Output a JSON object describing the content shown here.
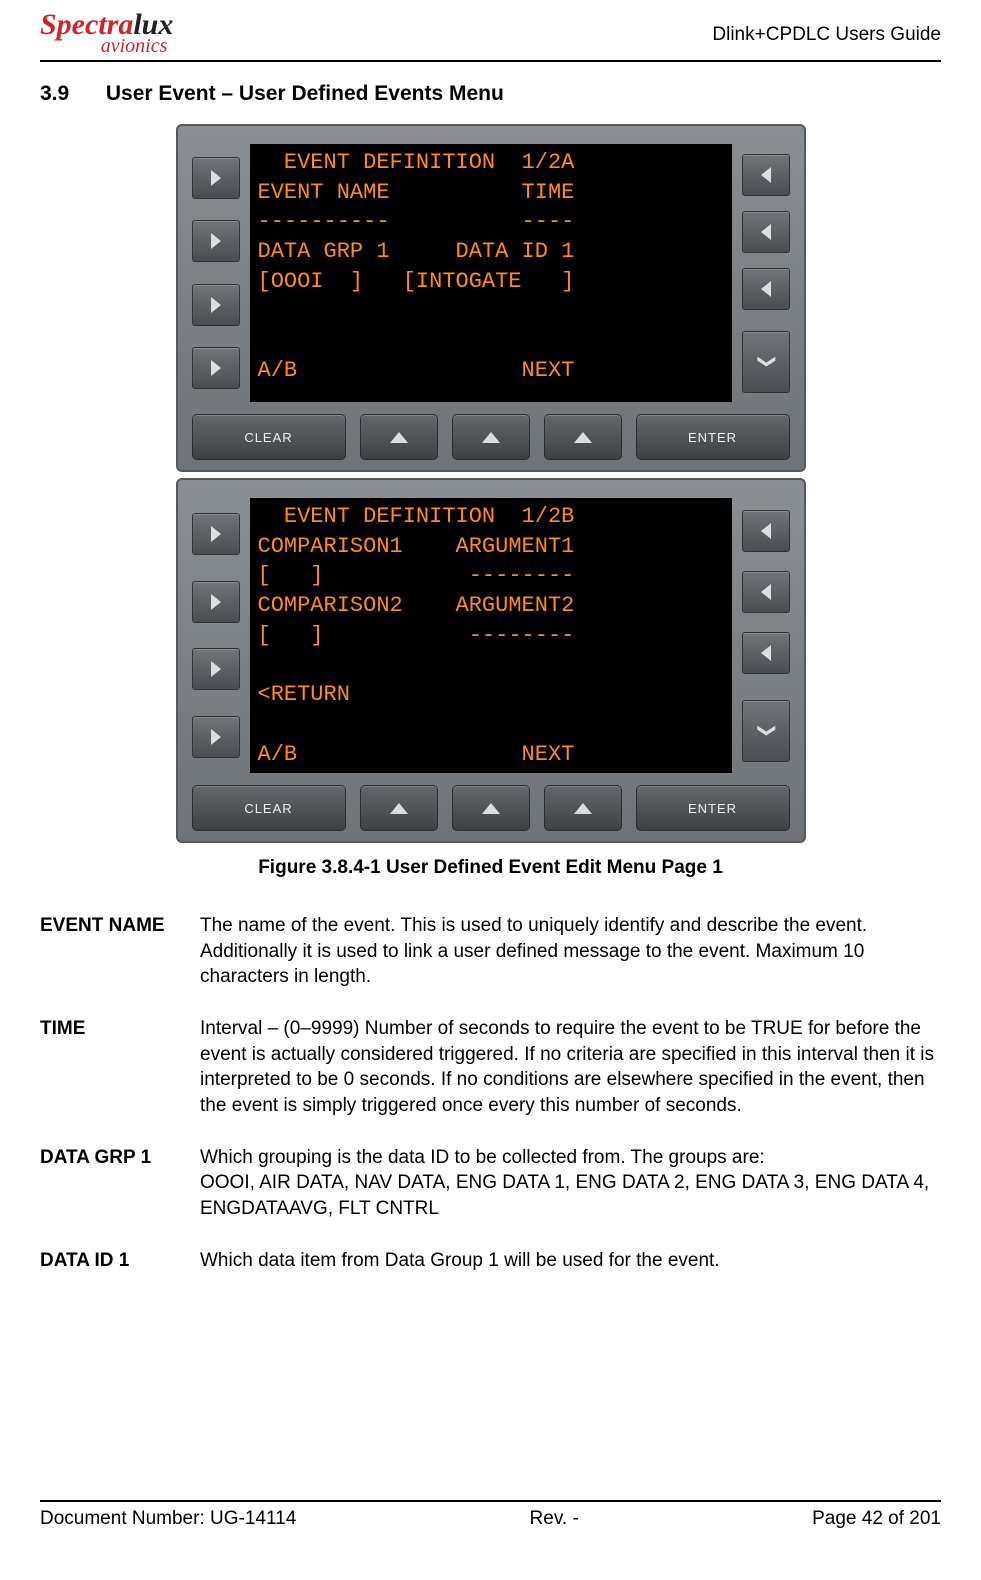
{
  "header": {
    "logo_part1": "Spectra",
    "logo_part2": "lux",
    "logo_sub": "avionics",
    "guide": "Dlink+CPDLC Users Guide"
  },
  "section": {
    "number": "3.9",
    "title": "User Event – User Defined Events Menu"
  },
  "screen1": {
    "l1": "  EVENT DEFINITION  1/2A",
    "l2": "EVENT NAME          TIME",
    "l3": "----------          ----",
    "l4": "DATA GRP 1     DATA ID 1",
    "l5": "[OOOI  ]   [INTOGATE   ]",
    "l6": "",
    "l7": "",
    "l8": "A/B                 NEXT"
  },
  "screen2": {
    "l1": "  EVENT DEFINITION  1/2B",
    "l2": "COMPARISON1    ARGUMENT1",
    "l3": "[   ]           --------",
    "l4": "COMPARISON2    ARGUMENT2",
    "l5": "[   ]           --------",
    "l6": "",
    "l7": "<RETURN",
    "l8": "",
    "l9": "A/B                 NEXT"
  },
  "buttons": {
    "clear": "CLEAR",
    "enter": "ENTER"
  },
  "caption": "Figure 3.8.4-1  User Defined Event Edit Menu Page 1",
  "defs": {
    "d1": {
      "label": "EVENT NAME",
      "text": "The name of the event. This is used to uniquely identify and describe the event. Additionally it is used to link a user defined message to the event. Maximum 10 characters in length."
    },
    "d2": {
      "label": "TIME",
      "text": "Interval – (0–9999) Number of seconds to require the event to be TRUE for before the event is actually considered triggered. If no criteria are specified in this interval then it is interpreted to be 0 seconds. If no conditions are elsewhere specified in the event, then the event is simply triggered once every this number of seconds."
    },
    "d3": {
      "label": "DATA GRP 1",
      "text": "Which grouping is the data ID to be collected from.  The groups are:\nOOOI, AIR DATA, NAV DATA, ENG DATA 1, ENG DATA 2, ENG DATA 3, ENG DATA 4, ENGDATAAVG, FLT CNTRL"
    },
    "d4": {
      "label": "DATA ID 1",
      "text": "Which data item from Data Group 1 will be used for the event."
    }
  },
  "footer": {
    "left": "Document Number:  UG-14114",
    "mid": "Rev. -",
    "right": "Page 42 of 201"
  }
}
